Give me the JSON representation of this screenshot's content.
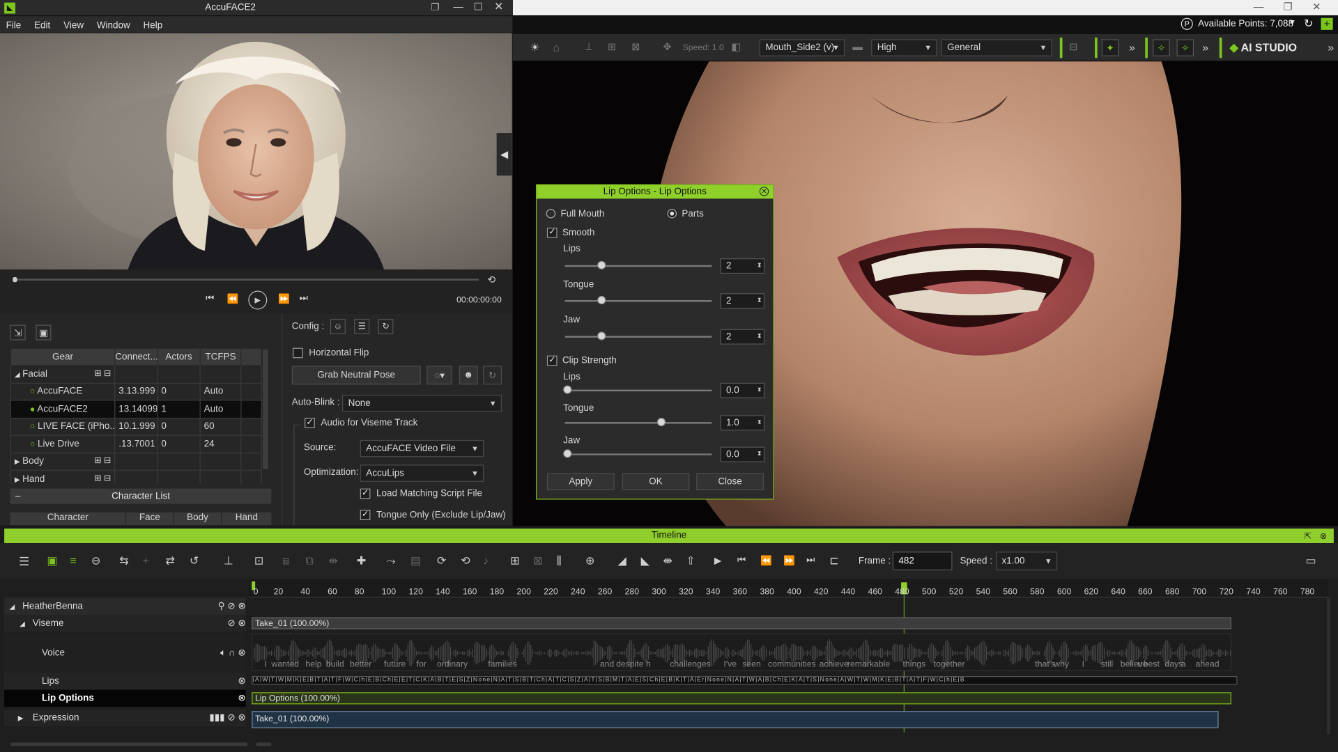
{
  "left_window": {
    "title": "AccuFACE2",
    "menu": [
      "File",
      "Edit",
      "View",
      "Window",
      "Help"
    ],
    "timecode": "00:00:00:00",
    "config_label": "Config :",
    "gear_table": {
      "headers": [
        "Gear",
        "Connect...",
        "Actors",
        "TCFPS"
      ],
      "facial_label": "Facial",
      "rows": [
        {
          "name": "AccuFACE",
          "connect": "3.13.999",
          "actors": "0",
          "tcfps": "Auto",
          "selected": false
        },
        {
          "name": "AccuFACE2",
          "connect": "13.14099",
          "actors": "1",
          "tcfps": "Auto",
          "selected": true
        },
        {
          "name": "LIVE FACE (iPho...",
          "connect": "10.1.999",
          "actors": "0",
          "tcfps": "60",
          "selected": false
        },
        {
          "name": "Live Drive",
          "connect": ".13.7001",
          "actors": "0",
          "tcfps": "24",
          "selected": false
        }
      ],
      "body_label": "Body",
      "hand_label": "Hand"
    },
    "character_list": {
      "title": "Character List",
      "headers": [
        "Character",
        "Face",
        "Body",
        "Hand"
      ]
    },
    "options": {
      "horizontal_flip": "Horizontal Flip",
      "grab_neutral_pose": "Grab Neutral Pose",
      "auto_blink_label": "Auto-Blink :",
      "auto_blink_value": "None",
      "audio_viseme": "Audio for Viseme Track",
      "source_label": "Source:",
      "source_value": "AccuFACE Video File",
      "optimization_label": "Optimization:",
      "optimization_value": "AccuLips",
      "load_script": "Load Matching Script File",
      "tongue_only": "Tongue Only (Exclude Lip/Jaw)"
    }
  },
  "right_window": {
    "available_points": "Available Points: 7,088",
    "toolbar": {
      "speed_label": "Speed: 1.0",
      "camera": "Mouth_Side2 (v)",
      "quality": "High",
      "mode": "General",
      "ai_studio": "AI STUDIO"
    }
  },
  "dialog": {
    "title": "Lip Options - Lip Options",
    "full_mouth": "Full Mouth",
    "parts": "Parts",
    "smooth": "Smooth",
    "smooth_sliders": [
      {
        "label": "Lips",
        "value": "2",
        "level": 0.25
      },
      {
        "label": "Tongue",
        "value": "2",
        "level": 0.25
      },
      {
        "label": "Jaw",
        "value": "2",
        "level": 0.25
      }
    ],
    "clip_strength": "Clip Strength",
    "strength_sliders": [
      {
        "label": "Lips",
        "value": "0.0",
        "level": 0.0
      },
      {
        "label": "Tongue",
        "value": "1.0",
        "level": 0.65
      },
      {
        "label": "Jaw",
        "value": "0.0",
        "level": 0.0
      }
    ],
    "apply": "Apply",
    "ok": "OK",
    "close": "Close"
  },
  "timeline": {
    "title": "Timeline",
    "frame_label": "Frame :",
    "frame_value": "482",
    "speed_label": "Speed :",
    "speed_value": "x1.00",
    "ticks": [
      "0",
      "20",
      "40",
      "60",
      "80",
      "100",
      "120",
      "140",
      "160",
      "180",
      "200",
      "220",
      "240",
      "260",
      "280",
      "300",
      "320",
      "340",
      "360",
      "380",
      "400",
      "420",
      "440",
      "460",
      "480",
      "500",
      "520",
      "540",
      "560",
      "580",
      "600",
      "620",
      "640",
      "660",
      "680",
      "700",
      "720",
      "740",
      "760",
      "780"
    ],
    "tracks": {
      "character": "HeatherBenna",
      "viseme": "Viseme",
      "voice": "Voice",
      "lips": "Lips",
      "lip_options": "Lip Options",
      "expression": "Expression"
    },
    "clips": {
      "viseme_clip": "Take_01 (100.00%)",
      "lip_options_clip": "Lip Options (100.00%)",
      "expression_clip": "Take_01 (100.00%)"
    },
    "voice_words": [
      "I",
      "wanted",
      "help",
      "build",
      "better",
      "future",
      "for",
      "ordinary",
      "families",
      "and",
      "despite",
      "h",
      "challenges",
      "I've",
      "seen",
      "communities",
      "achieve",
      "remarkable",
      "things",
      "together",
      "that's",
      "why",
      "I",
      "still",
      "believe",
      "u",
      "best",
      "days",
      "a",
      "ahead"
    ]
  }
}
